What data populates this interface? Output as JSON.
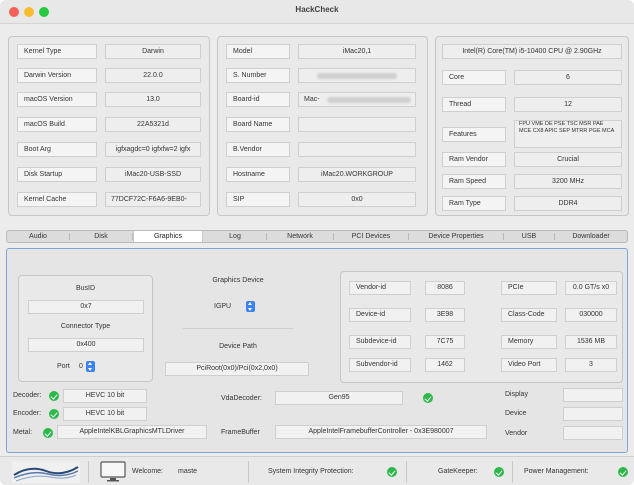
{
  "window": {
    "title": "HackCheck",
    "traffic_lights": [
      "#f45f57",
      "#f9bc2e",
      "#28c840"
    ]
  },
  "system": [
    {
      "label": "Kernel Type",
      "value": "Darwin"
    },
    {
      "label": "Darwin Version",
      "value": "22.0.0"
    },
    {
      "label": "macOS Version",
      "value": "13.0"
    },
    {
      "label": "macOS Build",
      "value": "22A5321d"
    },
    {
      "label": "Boot Arg",
      "value": "igfxagdc=0 igfxfw=2 igfx"
    },
    {
      "label": "Disk Startup",
      "value": "iMac20-USB-SSD"
    },
    {
      "label": "Kernel Cache",
      "value": "77DCF72C-F6A6-9EB0-"
    }
  ],
  "model": [
    {
      "label": "Model",
      "value": "iMac20,1"
    },
    {
      "label": "S. Number",
      "value": ""
    },
    {
      "label": "Board-id",
      "value": "Mac-"
    },
    {
      "label": "Board Name",
      "value": ""
    },
    {
      "label": "B.Vendor",
      "value": ""
    },
    {
      "label": "Hostname",
      "value": "iMac20.WORKGROUP"
    },
    {
      "label": "SIP",
      "value": "0x0"
    }
  ],
  "cpu": {
    "name": "Intel(R) Core(TM) i5-10400 CPU @ 2.90GHz",
    "rows": [
      {
        "label": "Core",
        "value": "6"
      },
      {
        "label": "Thread",
        "value": "12"
      },
      {
        "label": "Features",
        "value": "FPU VME DE PSE TSC MSR PAE MCE CX8 APIC SEP MTRR PGE MCA"
      },
      {
        "label": "Ram Vendor",
        "value": "Crucial"
      },
      {
        "label": "Ram Speed",
        "value": "3200 MHz"
      },
      {
        "label": "Ram Type",
        "value": "DDR4"
      }
    ]
  },
  "tabs": [
    "Audio",
    "Disk",
    "Graphics",
    "Log",
    "Network",
    "PCI Devices",
    "Device Properties",
    "USB",
    "Downloader"
  ],
  "active_tab": "Graphics",
  "graphics": {
    "busid_label": "BusID",
    "busid_value": "0x7",
    "connector_type_label": "Connector Type",
    "connector_type_value": "0x400",
    "port_label": "Port",
    "port_value": "0",
    "device_label": "Graphics Device",
    "device_value": "IGPU",
    "device_path_label": "Device Path",
    "device_path_value": "PciRoot(0x0)/Pci(0x2,0x0)",
    "ids_left": [
      {
        "label": "Vendor-id",
        "value": "8086"
      },
      {
        "label": "Device-id",
        "value": "3E98"
      },
      {
        "label": "Subdevice-id",
        "value": "7C75"
      },
      {
        "label": "Subvendor-id",
        "value": "1462"
      }
    ],
    "ids_right": [
      {
        "label": "PCIe",
        "value": "0.0 GT/s x0"
      },
      {
        "label": "Class-Code",
        "value": "030000"
      },
      {
        "label": "Memory",
        "value": "1536 MB"
      },
      {
        "label": "Video Port",
        "value": "3"
      }
    ],
    "decoder_label": "Decoder:",
    "decoder_value": "HEVC 10 bit",
    "encoder_label": "Encoder:",
    "encoder_value": "HEVC 10 bit",
    "metal_label": "Metal:",
    "metal_value": "AppleIntelKBLGraphicsMTLDriver",
    "vda_label": "VdaDecoder:",
    "vda_value": "Gen95",
    "framebuffer_label": "FrameBuffer",
    "framebuffer_value": "AppleIntelFramebufferController - 0x3E980007",
    "display_label": "Display",
    "device2_label": "Device",
    "vendor_label": "Vendor"
  },
  "footer": {
    "welcome_label": "Welcome:",
    "welcome_user": "maste",
    "sip_label": "System Integrity Protection:",
    "gatekeeper_label": "GateKeeper:",
    "power_label": "Power Management:"
  }
}
